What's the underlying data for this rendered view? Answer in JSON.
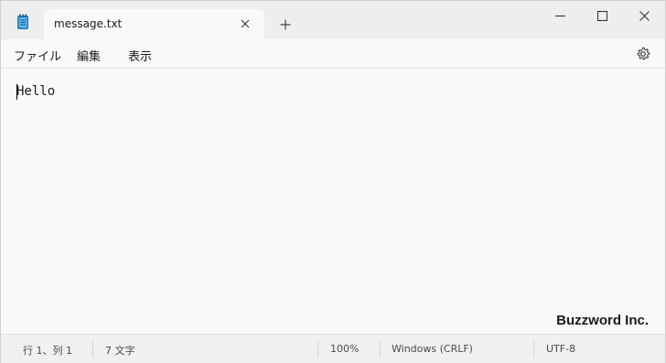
{
  "tab": {
    "title": "message.txt"
  },
  "menu": [
    "ファイル",
    "編集",
    "表示"
  ],
  "editor": {
    "content": "Hello"
  },
  "watermark": "Buzzword Inc.",
  "status": {
    "position": "行 1、列 1",
    "char_count": "7 文字",
    "zoom": "100%",
    "line_ending": "Windows (CRLF)",
    "encoding": "UTF-8"
  },
  "icons": [
    "notepad-icon",
    "close-icon",
    "plus-icon",
    "minimize-icon",
    "maximize-icon",
    "window-close-icon",
    "gear-icon"
  ]
}
